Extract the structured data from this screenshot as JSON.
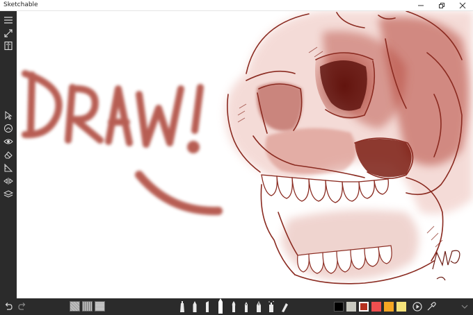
{
  "window": {
    "title": "Sketchable"
  },
  "title_controls": [
    {
      "name": "minimize-button",
      "icon": "minimize-icon"
    },
    {
      "name": "maximize-button",
      "icon": "maximize-icon"
    },
    {
      "name": "close-button",
      "icon": "close-icon"
    }
  ],
  "sidebar": {
    "top_tools": [
      "menu-icon",
      "fullscreen-icon",
      "journal-icon"
    ],
    "tools": [
      "select-icon",
      "color-icon",
      "visibility-icon",
      "eraser-icon",
      "ruler-icon",
      "symmetry-icon",
      "layers-icon"
    ]
  },
  "canvas": {
    "ink_color": "#a83a2e",
    "doodle_text": "DRAW!"
  },
  "bottombar": {
    "history": [
      "undo-icon",
      "redo-icon"
    ],
    "textures": [
      "paper-texture-1",
      "paper-texture-2",
      "paper-texture-3"
    ],
    "tools": [
      "marker-tool",
      "pencil-tool",
      "chisel-pen-tool",
      "airbrush-tool",
      "brush-tool",
      "pen-tool",
      "fountain-pen-tool",
      "spray-tool",
      "smudge-tool"
    ],
    "selected_tool": "airbrush-tool",
    "colors": [
      "#000000",
      "#c9c9c0",
      "#b5301f",
      "#ef4f4f",
      "#f5a623",
      "#f4e27a"
    ],
    "selected_color": "#b5301f",
    "extras": [
      "play-icon",
      "eyedropper-icon",
      "collapse-icon"
    ]
  }
}
